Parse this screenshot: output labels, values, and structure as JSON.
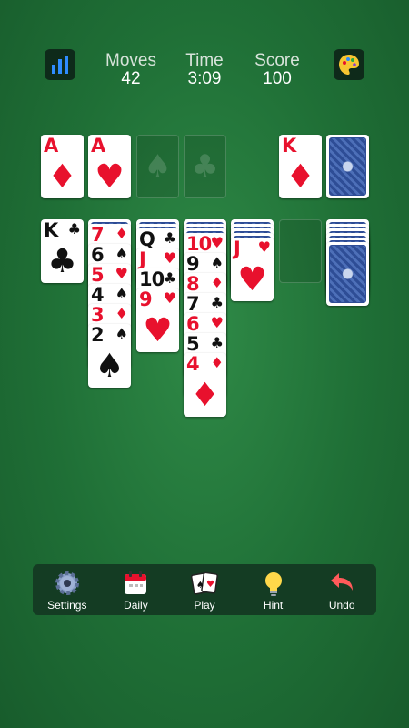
{
  "hud": {
    "moves_label": "Moves",
    "moves_value": "42",
    "time_label": "Time",
    "time_value": "3:09",
    "score_label": "Score",
    "score_value": "100",
    "stats_icon": "bar-chart-icon",
    "theme_icon": "palette-icon"
  },
  "foundations": [
    {
      "rank": "A",
      "suit": "♦",
      "color": "red"
    },
    {
      "rank": "A",
      "suit": "♥",
      "color": "red"
    },
    {
      "empty_suit": "♠"
    },
    {
      "empty_suit": "♣"
    }
  ],
  "waste": {
    "rank": "K",
    "suit": "♦",
    "color": "red"
  },
  "stock": {
    "face": "down"
  },
  "tableau": [
    {
      "facedown": 0,
      "cards": [
        {
          "rank": "K",
          "suit": "♣",
          "color": "black"
        }
      ]
    },
    {
      "facedown": 1,
      "cards": [
        {
          "rank": "7",
          "suit": "♦",
          "color": "red"
        },
        {
          "rank": "6",
          "suit": "♠",
          "color": "black"
        },
        {
          "rank": "5",
          "suit": "♥",
          "color": "red"
        },
        {
          "rank": "4",
          "suit": "♠",
          "color": "black"
        },
        {
          "rank": "3",
          "suit": "♦",
          "color": "red"
        },
        {
          "rank": "2",
          "suit": "♠",
          "color": "black"
        }
      ]
    },
    {
      "facedown": 2,
      "cards": [
        {
          "rank": "Q",
          "suit": "♣",
          "color": "black"
        },
        {
          "rank": "J",
          "suit": "♥",
          "color": "red"
        },
        {
          "rank": "10",
          "suit": "♣",
          "color": "black"
        },
        {
          "rank": "9",
          "suit": "♥",
          "color": "red"
        }
      ]
    },
    {
      "facedown": 3,
      "cards": [
        {
          "rank": "10",
          "suit": "♥",
          "color": "red"
        },
        {
          "rank": "9",
          "suit": "♠",
          "color": "black"
        },
        {
          "rank": "8",
          "suit": "♦",
          "color": "red"
        },
        {
          "rank": "7",
          "suit": "♣",
          "color": "black"
        },
        {
          "rank": "6",
          "suit": "♥",
          "color": "red"
        },
        {
          "rank": "5",
          "suit": "♣",
          "color": "black"
        },
        {
          "rank": "4",
          "suit": "♦",
          "color": "red"
        }
      ]
    },
    {
      "facedown": 4,
      "cards": [
        {
          "rank": "J",
          "suit": "♥",
          "color": "red"
        }
      ]
    },
    {
      "facedown": 0,
      "cards": []
    },
    {
      "facedown": 6,
      "cards": []
    }
  ],
  "toolbar": {
    "settings": {
      "label": "Settings",
      "icon": "gear-icon"
    },
    "daily": {
      "label": "Daily",
      "icon": "calendar-icon"
    },
    "play": {
      "label": "Play",
      "icon": "cards-icon"
    },
    "hint": {
      "label": "Hint",
      "icon": "lightbulb-icon"
    },
    "undo": {
      "label": "Undo",
      "icon": "undo-arrow-icon"
    }
  },
  "colors": {
    "felt": "#1f6f36",
    "red": "#e8112d",
    "black": "#111111",
    "toolbar": "#143c23"
  }
}
